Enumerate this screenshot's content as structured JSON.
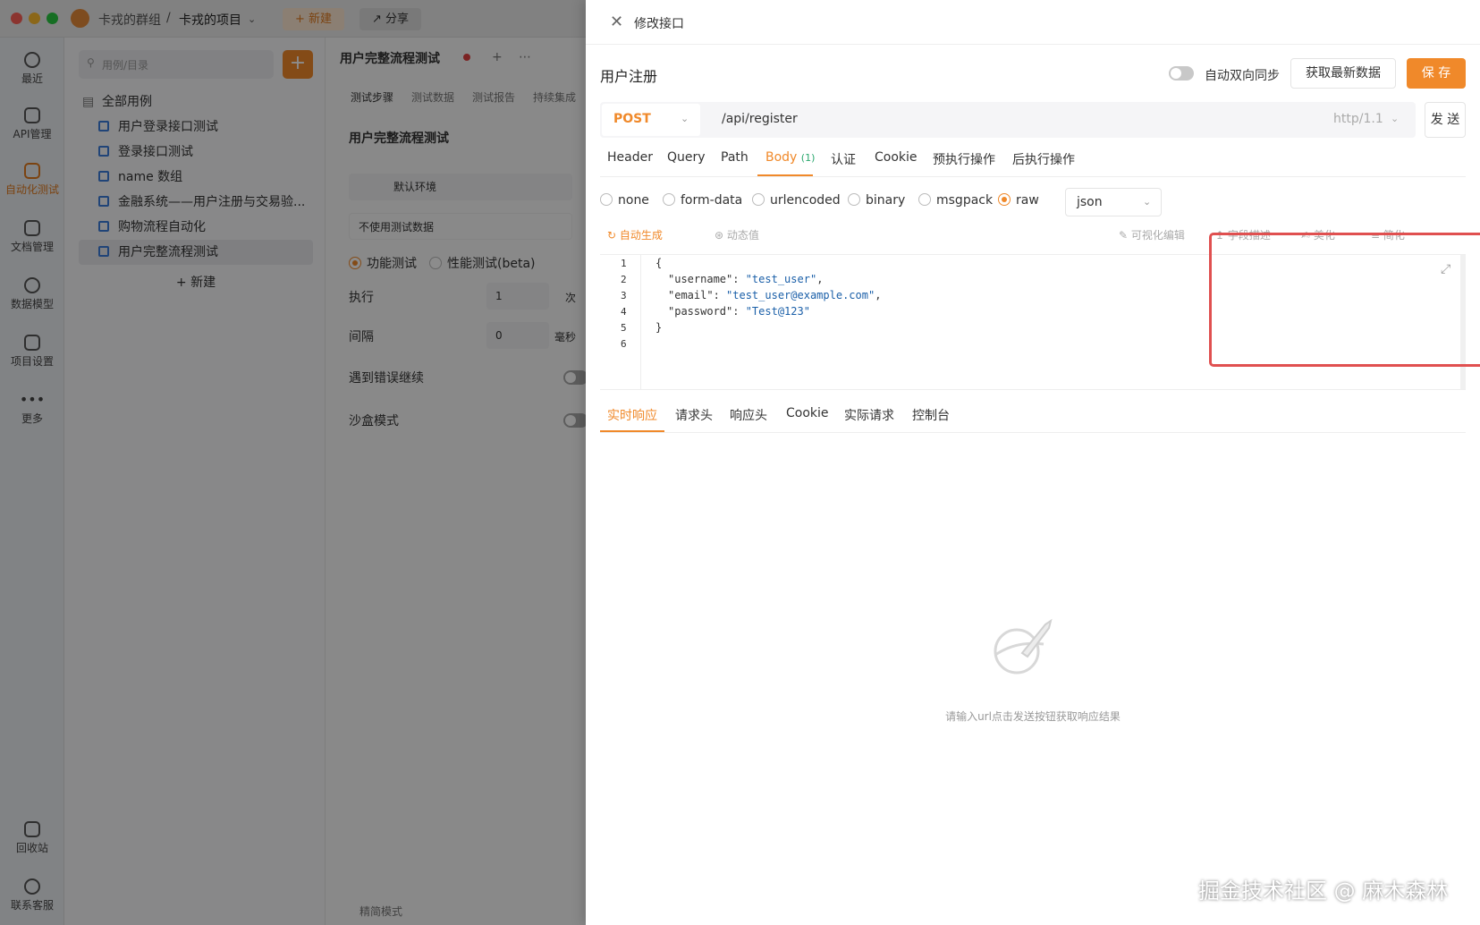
{
  "titlebar": {
    "group": "卡戎的群组",
    "separator": "/",
    "project": "卡戎的项目",
    "new_label": "+ 新建",
    "share_label": "分享"
  },
  "leftnav": {
    "items": [
      {
        "label": "最近",
        "icon": "clock-icon"
      },
      {
        "label": "API管理",
        "icon": "api-icon"
      },
      {
        "label": "自动化测试",
        "icon": "automation-icon",
        "active": true
      },
      {
        "label": "文档管理",
        "icon": "doc-icon"
      },
      {
        "label": "数据模型",
        "icon": "model-icon"
      },
      {
        "label": "项目设置",
        "icon": "settings-icon"
      },
      {
        "label": "更多",
        "icon": "more-icon"
      }
    ],
    "bottom": [
      {
        "label": "回收站",
        "icon": "trash-icon"
      },
      {
        "label": "联系客服",
        "icon": "headset-icon"
      }
    ]
  },
  "tree": {
    "search_placeholder": "用例/目录",
    "add_label": "+",
    "root": "全部用例",
    "items": [
      "用户登录接口测试",
      "登录接口测试",
      "name 数组",
      "金融系统——用户注册与交易验...",
      "购物流程自动化",
      "用户完整流程测试"
    ],
    "new_label": "+ 新建"
  },
  "middle": {
    "tab_title": "用户完整流程测试",
    "tabs": [
      "测试步骤",
      "测试数据",
      "测试报告",
      "持续集成"
    ],
    "heading": "用户完整流程测试",
    "env": "默认环境",
    "test_data": "不使用测试数据",
    "mode_functional": "功能测试",
    "mode_performance": "性能测试(beta)",
    "exec_label": "执行",
    "exec_value": "1",
    "exec_unit": "次",
    "interval_label": "间隔",
    "interval_value": "0",
    "interval_unit": "毫秒",
    "on_error_label": "遇到错误继续",
    "sandbox_label": "沙盒模式",
    "footer": "精简模式"
  },
  "drawer": {
    "title": "修改接口",
    "api_name": "用户注册",
    "sync_label": "自动双向同步",
    "fetch_label": "获取最新数据",
    "save_label": "保 存",
    "method": "POST",
    "url": "/api/register",
    "protocol": "http/1.1",
    "send_label": "发 送",
    "req_tabs": [
      "Header",
      "Query",
      "Path",
      "Body",
      "认证",
      "Cookie",
      "预执行操作",
      "后执行操作"
    ],
    "body_badge": "(1)",
    "body_types": [
      "none",
      "form-data",
      "urlencoded",
      "binary",
      "msgpack",
      "raw"
    ],
    "body_type_selected": "raw",
    "format": "json",
    "tools": {
      "auto_generate": "自动生成",
      "dynamic_value": "动态值",
      "visual_edit": "可视化编辑",
      "field_desc": "字段描述",
      "beautify": "美化",
      "simplify": "简化"
    },
    "code_lines": [
      {
        "n": "1",
        "text": "{"
      },
      {
        "n": "2",
        "key": "\"username\"",
        "val": "\"test_user\"",
        "tail": ","
      },
      {
        "n": "3",
        "key": "\"email\"",
        "val": "\"test_user@example.com\"",
        "tail": ","
      },
      {
        "n": "4",
        "key": "\"password\"",
        "val": "\"Test@123\"",
        "tail": ""
      },
      {
        "n": "5",
        "text": "}"
      },
      {
        "n": "6",
        "text": ""
      }
    ],
    "resp_tabs": [
      "实时响应",
      "请求头",
      "响应头",
      "Cookie",
      "实际请求",
      "控制台"
    ],
    "empty_text": "请输入url点击发送按钮获取响应结果"
  },
  "colors": {
    "accent": "#f0892a",
    "highlight": "#e05050",
    "string": "#1a5fa8"
  },
  "watermark": "掘金技术社区 @ 麻木森林"
}
